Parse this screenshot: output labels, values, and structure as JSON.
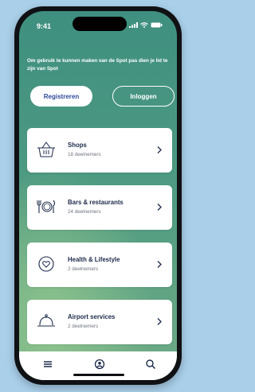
{
  "status": {
    "time": "9:41"
  },
  "intro_text": "Om gebruik te kunnen maken van de Spot pas dien je lid te zijn van Spot",
  "buttons": {
    "register": "Registreren",
    "login": "Inloggen"
  },
  "categories": [
    {
      "title": "Shops",
      "subtitle": "18 deelnemers",
      "icon": "basket-icon"
    },
    {
      "title": "Bars & restaurants",
      "subtitle": "24 deelnemers",
      "icon": "cutlery-icon"
    },
    {
      "title": "Health & Lifestyle",
      "subtitle": "2 deelnemers",
      "icon": "heart-icon"
    },
    {
      "title": "Airport services",
      "subtitle": "2 deelnemers",
      "icon": "cloche-icon"
    }
  ],
  "tabbar": {
    "items": [
      "menu-icon",
      "profile-icon",
      "search-icon"
    ]
  },
  "colors": {
    "background": "#a9cfe9",
    "accent_text": "#2d4a9a",
    "screen_green": "#4d9a82"
  }
}
